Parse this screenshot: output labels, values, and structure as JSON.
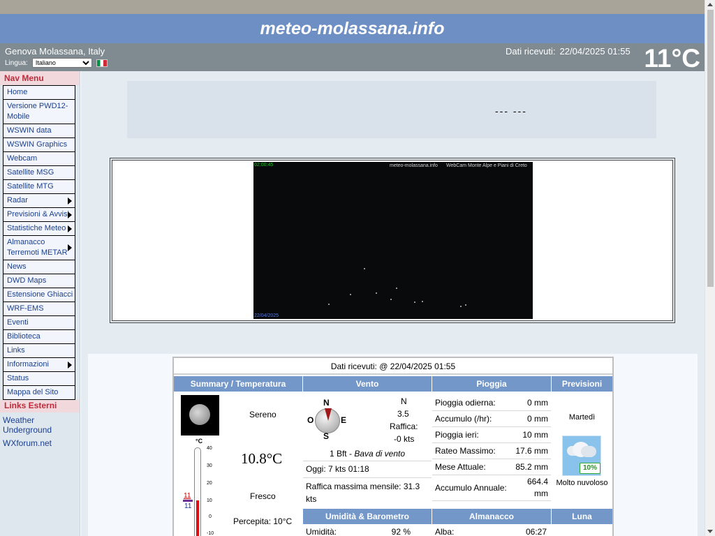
{
  "site_title": "meteo-molassana.info",
  "location": "Genova Molassana, Italy",
  "language": {
    "label": "Lingua:",
    "selected": "Italiano"
  },
  "received": {
    "label": "Dati ricevuti:",
    "datetime": "22/04/2025 01:55"
  },
  "current_temp": "11°C",
  "nav": {
    "title": "Nav Menu",
    "items": [
      {
        "label": "Home"
      },
      {
        "label": "Versione PWD12-Mobile"
      },
      {
        "label": "WSWIN data"
      },
      {
        "label": "WSWIN Graphics"
      },
      {
        "label": "Webcam"
      },
      {
        "label": "Satellite MSG"
      },
      {
        "label": "Satellite MTG"
      },
      {
        "label": "Radar"
      },
      {
        "label": "Previsioni & Avvisi"
      },
      {
        "label": "Statistiche Meteo"
      },
      {
        "label": "Almanacco Terremoti METAR"
      },
      {
        "label": "News"
      },
      {
        "label": "DWD Maps"
      },
      {
        "label": "Estensione Ghiacci"
      },
      {
        "label": "WRF-EMS"
      },
      {
        "label": "Eventi"
      },
      {
        "label": "Biblioteca"
      },
      {
        "label": "Links"
      },
      {
        "label": "Informazioni"
      },
      {
        "label": "Status"
      },
      {
        "label": "Mappa del Sito"
      }
    ]
  },
  "external": {
    "title": "Links Esterni",
    "items": [
      {
        "label": "Weather Underground"
      },
      {
        "label": "WXforum.net"
      }
    ]
  },
  "banner_text": "---  ---",
  "webcam": {
    "timestamp": "02:00:45",
    "site": "meteo-molassana.info",
    "camera": "WebCam Monte Alpe e Piani di Creto",
    "date": "22/04/2025"
  },
  "table": {
    "received_line": "Dati ricevuti: @ 22/04/2025 01:55",
    "headers": {
      "summary": "Summary / Temperatura",
      "wind": "Vento",
      "rain": "Pioggia",
      "forecast": "Previsioni",
      "humidity": "Umidità & Barometro",
      "almanac": "Almanacco",
      "moon": "Luna"
    },
    "summary": {
      "condition": "Sereno",
      "temperature": "10.8°C",
      "feeling": "Fresco",
      "perceived": "Percepita: 10°C",
      "thermo_unit": "°C",
      "thermo_ticks": [
        "40",
        "30",
        "20",
        "10",
        "0",
        "-10"
      ],
      "thermo_max": "11",
      "thermo_min": "11"
    },
    "wind": {
      "compass_n": "N",
      "compass_s": "S",
      "compass_e": "E",
      "compass_o": "O",
      "direction": "N",
      "speed": "3.5",
      "gust_label": "Raffica:",
      "gust": "-0 kts",
      "beaufort": "1 Bft -",
      "beaufort_desc": "Bava di vento",
      "today": "Oggi: 7 kts 01:18",
      "monthly_max": "Raffica massima mensile: 31.3 kts"
    },
    "rain": [
      {
        "label": "Pioggia odierna:",
        "value": "0 mm"
      },
      {
        "label": "Accumulo (/hr):",
        "value": "0 mm"
      },
      {
        "label": "Pioggia ieri:",
        "value": "10 mm"
      },
      {
        "label": "Rateo Massimo:",
        "value": "17.6 mm"
      },
      {
        "label": "Mese Attuale:",
        "value": "85.2 mm"
      },
      {
        "label": "Accumulo Annuale:",
        "value": "664.4 mm"
      }
    ],
    "forecast": {
      "day": "Martedì",
      "percent": "10%",
      "description": "Molto nuvoloso"
    },
    "humidity_row": {
      "label": "Umidità:",
      "value": "92 %"
    },
    "almanac_row": {
      "label": "Alba:",
      "value": "06:27"
    }
  }
}
